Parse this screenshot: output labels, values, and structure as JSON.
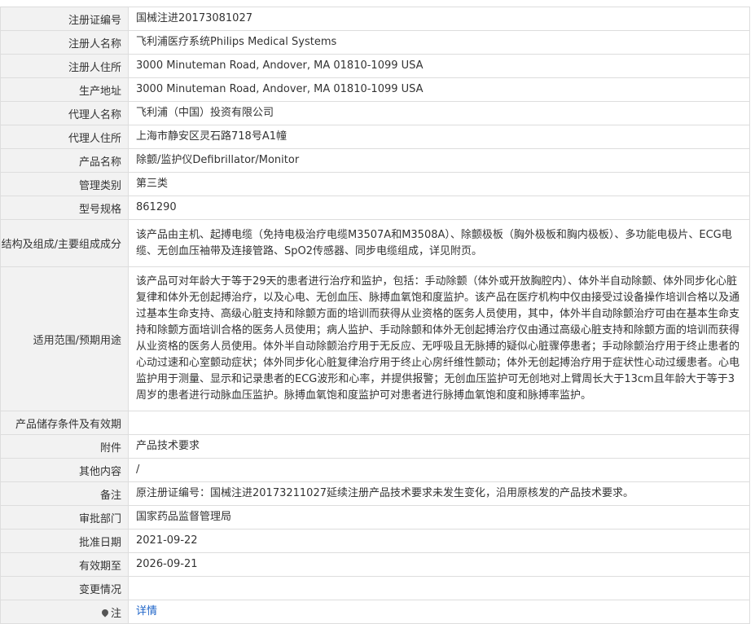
{
  "rows": [
    {
      "label": "注册证编号",
      "value": "国械注进20173081027"
    },
    {
      "label": "注册人名称",
      "value": "飞利浦医疗系统Philips Medical Systems"
    },
    {
      "label": "注册人住所",
      "value": "3000 Minuteman Road, Andover, MA 01810-1099 USA"
    },
    {
      "label": "生产地址",
      "value": "3000 Minuteman Road, Andover, MA 01810-1099 USA"
    },
    {
      "label": "代理人名称",
      "value": "飞利浦（中国）投资有限公司"
    },
    {
      "label": "代理人住所",
      "value": "上海市静安区灵石路718号A1幢"
    },
    {
      "label": "产品名称",
      "value": "除颤/监护仪Defibrillator/Monitor"
    },
    {
      "label": "管理类别",
      "value": "第三类"
    },
    {
      "label": "型号规格",
      "value": "861290"
    },
    {
      "label": "结构及组成/主要组成成分",
      "value": "该产品由主机、起搏电缆（免持电极治疗电缆M3507A和M3508A）、除颤极板（胸外极板和胸内极板）、多功能电极片、ECG电缆、无创血压袖带及连接管路、SpO2传感器、同步电缆组成，详见附页。"
    },
    {
      "label": "适用范围/预期用途",
      "value": "该产品可对年龄大于等于29天的患者进行治疗和监护，包括：手动除颤（体外或开放胸腔内）、体外半自动除颤、体外同步化心脏复律和体外无创起搏治疗，以及心电、无创血压、脉搏血氧饱和度监护。该产品在医疗机构中仅由接受过设备操作培训合格以及通过基本生命支持、高级心脏支持和除颤方面的培训而获得从业资格的医务人员使用，其中，体外半自动除颤治疗可由在基本生命支持和除颤方面培训合格的医务人员使用；病人监护、手动除颤和体外无创起搏治疗仅由通过高级心脏支持和除颤方面的培训而获得从业资格的医务人员使用。体外半自动除颤治疗用于无反应、无呼吸且无脉搏的疑似心脏骤停患者；手动除颤治疗用于终止患者的心动过速和心室颤动症状；体外同步化心脏复律治疗用于终止心房纤维性颤动；体外无创起搏治疗用于症状性心动过缓患者。心电监护用于测量、显示和记录患者的ECG波形和心率，并提供报警；无创血压监护可无创地对上臂周长大于13cm且年龄大于等于3周岁的患者进行动脉血压监护。脉搏血氧饱和度监护可对患者进行脉搏血氧饱和度和脉搏率监护。"
    },
    {
      "label": "产品储存条件及有效期",
      "value": ""
    },
    {
      "label": "附件",
      "value": "产品技术要求"
    },
    {
      "label": "其他内容",
      "value": "/"
    },
    {
      "label": "备注",
      "value": "原注册证编号：国械注进20173211027延续注册产品技术要求未发生变化，沿用原核发的产品技术要求。"
    },
    {
      "label": "审批部门",
      "value": "国家药品监督管理局"
    },
    {
      "label": "批准日期",
      "value": "2021-09-22"
    },
    {
      "label": "有效期至",
      "value": "2026-09-21"
    },
    {
      "label": "变更情况",
      "value": ""
    }
  ],
  "note": {
    "label": "注",
    "link": "详情"
  }
}
